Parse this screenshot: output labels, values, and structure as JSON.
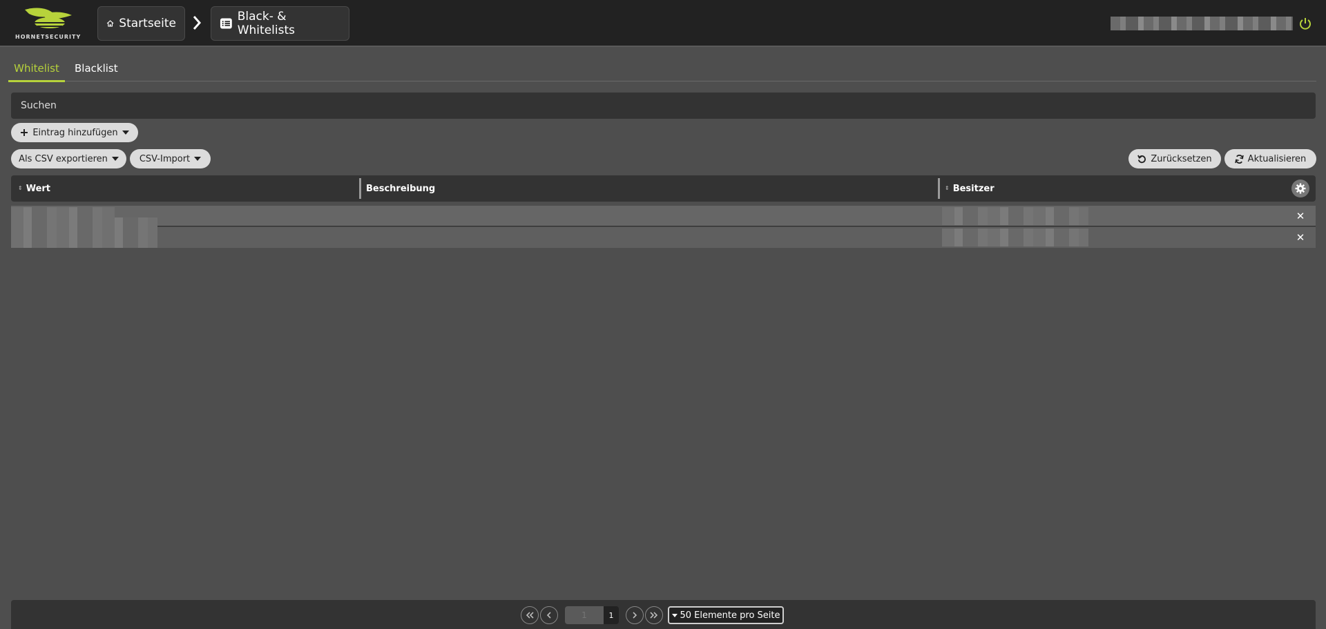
{
  "brand": {
    "logo_text": "HORNETSECURITY",
    "accent_color": "#b7d33b"
  },
  "breadcrumb": {
    "home_label": "Startseite",
    "home_icon": "home-icon",
    "current_label": "Black- & Whitelists",
    "current_icon": "list-icon"
  },
  "tabs": [
    {
      "label": "Whitelist",
      "active": true
    },
    {
      "label": "Blacklist",
      "active": false
    }
  ],
  "search": {
    "placeholder": "Suchen"
  },
  "toolbar": {
    "add_label": "Eintrag hinzufügen",
    "export_label": "Als CSV exportieren",
    "import_label": "CSV-Import",
    "reset_label": "Zurücksetzen",
    "refresh_label": "Aktualisieren"
  },
  "table": {
    "columns": [
      "Wert",
      "Beschreibung",
      "Besitzer"
    ],
    "row_count": 2
  },
  "pagination": {
    "current_page": "1",
    "total_pages": "1",
    "per_page_label": "50 Elemente pro Seite"
  }
}
